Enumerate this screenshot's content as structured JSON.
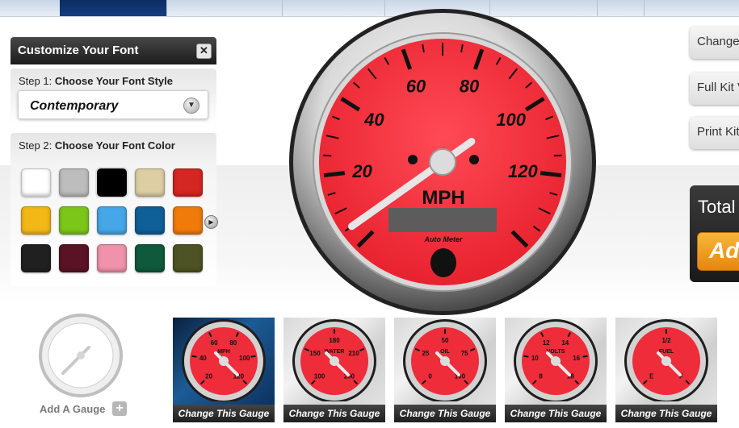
{
  "left_panel": {
    "title": "Customize Your Font",
    "step1": {
      "prefix": "Step 1:",
      "label": "Choose Your Font Style",
      "selected": "Contemporary"
    },
    "step2": {
      "prefix": "Step 2:",
      "label": "Choose Your Font Color"
    },
    "colors": [
      "#ffffff",
      "#bdbdbd",
      "#000000",
      "#ddcfa3",
      "#d42622",
      "#f3b716",
      "#7cc61a",
      "#45a6e8",
      "#0f5f98",
      "#f07b0a",
      "#202020",
      "#5a1324",
      "#f092ab",
      "#0f5a3c",
      "#4d5324"
    ],
    "selected_color_index": 2
  },
  "main_gauge": {
    "unit": "MPH",
    "ticks": [
      "20",
      "40",
      "60",
      "80",
      "100",
      "120"
    ],
    "brand": "Auto Meter",
    "face_color": "#ef2b3a",
    "needle_value": 5
  },
  "right_panel": {
    "buttons": [
      "Change",
      "Full Kit V",
      "Print Kit"
    ],
    "total_label": "Total",
    "add_label": "Ad"
  },
  "bottom": {
    "add_gauge_label": "Add A Gauge",
    "thumb_cta": "Change This Gauge",
    "thumbs": [
      {
        "unit": "MPH",
        "ticks": [
          "20",
          "40",
          "60",
          "80",
          "100",
          "120"
        ]
      },
      {
        "unit": "WATER",
        "ticks": [
          "100",
          "150",
          "180",
          "210",
          "250"
        ]
      },
      {
        "unit": "OIL",
        "ticks": [
          "0",
          "25",
          "50",
          "75",
          "100"
        ]
      },
      {
        "unit": "VOLTS",
        "ticks": [
          "8",
          "10",
          "12",
          "14",
          "16",
          "18"
        ]
      },
      {
        "unit": "FUEL",
        "ticks": [
          "E",
          "1/2",
          "F"
        ]
      }
    ]
  }
}
